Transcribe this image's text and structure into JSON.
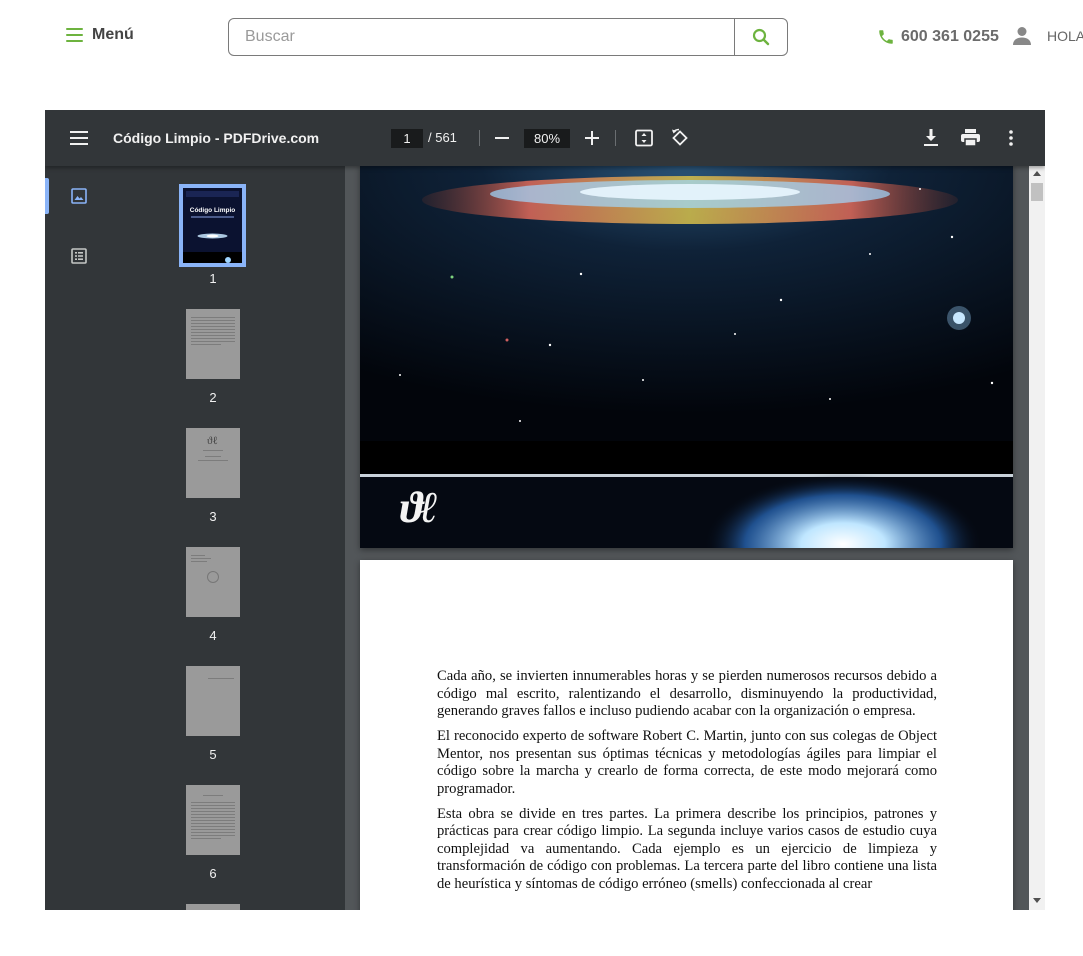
{
  "header": {
    "menu_label": "Menú",
    "search_placeholder": "Buscar",
    "phone": "600 361 0255",
    "user_label": "HOLA"
  },
  "viewer": {
    "title": "Código Limpio - PDFDrive.com",
    "current_page": "1",
    "total_pages": "/ 561",
    "zoom": "80%",
    "thumbnails": [
      {
        "label": "1"
      },
      {
        "label": "2"
      },
      {
        "label": "3"
      },
      {
        "label": "4"
      },
      {
        "label": "5"
      },
      {
        "label": "6"
      }
    ],
    "cover": {
      "title": "Código Limpio",
      "publisher_logo_text": "ϑℓ"
    },
    "page_text": [
      "Cada año, se invierten innumerables horas y se pierden numerosos recursos debido a código mal escrito, ralentizando el desarrollo, disminuyendo la productividad, generando graves fallos e incluso pudiendo acabar con la organización o empresa.",
      "El reconocido experto de software Robert C. Martin, junto con sus colegas de Object Mentor, nos presentan sus óptimas técnicas y metodologías ágiles para limpiar el código sobre la marcha y crearlo de forma correcta, de este modo mejorará como programador.",
      "Esta obra se divide en tres partes. La primera describe los principios, patrones y prácticas para crear código limpio. La segunda incluye varios casos de estudio cuya complejidad va aumentando. Cada ejemplo es un ejercicio de limpieza y transformación de código con problemas. La tercera parte del libro contiene una lista de heurística y síntomas de código erróneo (smells) confeccionada al crear"
    ]
  },
  "colors": {
    "brand_green": "#6db33f",
    "toolbar_bg": "#323639",
    "viewer_bg": "#525659",
    "thumb_selected": "#8ab4f8"
  },
  "icons": [
    "menu-icon",
    "search-icon",
    "phone-icon",
    "user-icon",
    "hamburger-icon",
    "zoom-out-icon",
    "zoom-in-icon",
    "fit-page-icon",
    "rotate-icon",
    "download-icon",
    "print-icon",
    "more-vert-icon",
    "thumbnail-view-icon",
    "outline-view-icon"
  ]
}
